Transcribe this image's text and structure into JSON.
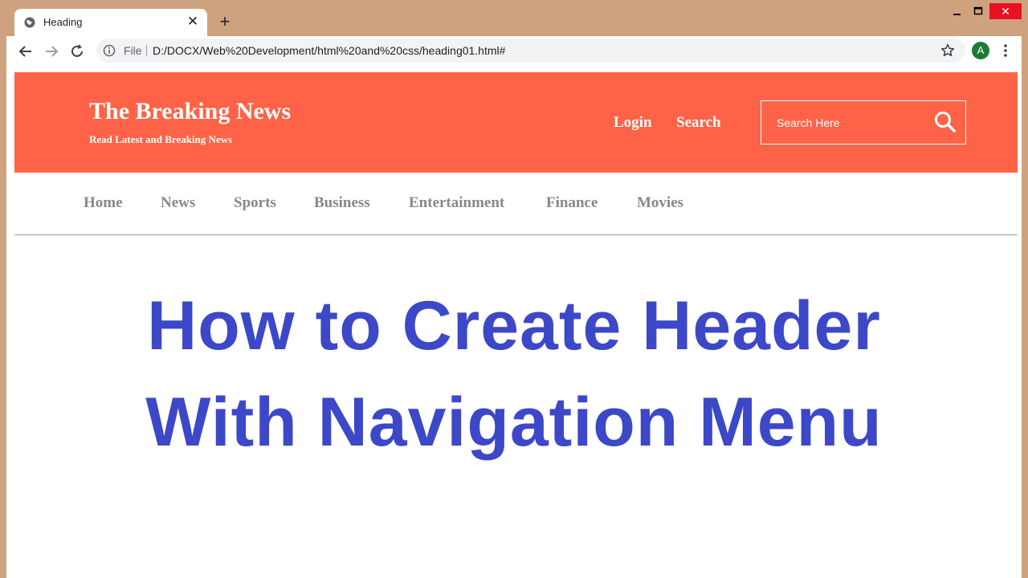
{
  "browser": {
    "tab_title": "Heading",
    "new_tab_label": "+",
    "omnibox": {
      "file_label": "File",
      "url": "D:/DOCX/Web%20Development/html%20and%20css/heading01.html#"
    },
    "avatar_initial": "A"
  },
  "site": {
    "title": "The Breaking News",
    "tagline": "Read Latest and Breaking News",
    "header_links": [
      "Login",
      "Search"
    ],
    "search": {
      "placeholder": "Search Here"
    },
    "nav": [
      "Home",
      "News",
      "Sports",
      "Business",
      "Entertainment",
      "Finance",
      "Movies"
    ],
    "accent_color": "#ff6347"
  },
  "overlay": {
    "line1": "How to Create Header",
    "line2": "With Navigation Menu",
    "color": "#3c48c8"
  }
}
